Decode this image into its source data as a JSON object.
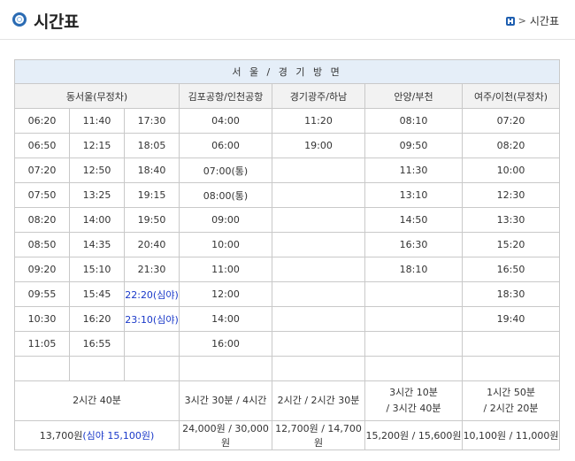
{
  "header": {
    "title": "시간표",
    "breadcrumb": "시간표"
  },
  "table": {
    "caption": "서 울 / 경 기 방 면",
    "columns": [
      "동서울(무정차)",
      "김포공항/인천공항",
      "경기광주/하남",
      "안양/부천",
      "여주/이천(무정차)"
    ],
    "rows": [
      [
        "06:20",
        "11:40",
        "17:30",
        "04:00",
        "11:20",
        "08:10",
        "07:20"
      ],
      [
        "06:50",
        "12:15",
        "18:05",
        "06:00",
        "19:00",
        "09:50",
        "08:20"
      ],
      [
        "07:20",
        "12:50",
        "18:40",
        "07:00(통)",
        "",
        "11:30",
        "10:00"
      ],
      [
        "07:50",
        "13:25",
        "19:15",
        "08:00(통)",
        "",
        "13:10",
        "12:30"
      ],
      [
        "08:20",
        "14:00",
        "19:50",
        "09:00",
        "",
        "14:50",
        "13:30"
      ],
      [
        "08:50",
        "14:35",
        "20:40",
        "10:00",
        "",
        "16:30",
        "15:20"
      ],
      [
        "09:20",
        "15:10",
        "21:30",
        "11:00",
        "",
        "18:10",
        "16:50"
      ],
      [
        "09:55",
        "15:45",
        "22:20(심야)",
        "12:00",
        "",
        "",
        "18:30"
      ],
      [
        "10:30",
        "16:20",
        "23:10(심야)",
        "14:00",
        "",
        "",
        "19:40"
      ],
      [
        "11:05",
        "16:55",
        "",
        "16:00",
        "",
        "",
        ""
      ],
      [
        "",
        "",
        "",
        "",
        "",
        "",
        ""
      ]
    ],
    "durations": [
      "2시간 40분",
      "3시간 30분 / 4시간",
      "2시간 / 2시간 30분",
      "3시간 10분 / 3시간 40분",
      "1시간 50분 / 2시간 20분"
    ],
    "fares": {
      "dongseoul": "13,700원",
      "dongseoul_night": "(심야 15,100원)",
      "gimpo": "24,000원 / 30,000원",
      "gwangju": "12,700원 / 14,700원",
      "anyang": "15,200원 / 15,600원",
      "yeoju": "10,100원 / 11,000원"
    }
  },
  "colors": {
    "accent": "#2a6bb3",
    "caption_bg": "#e5eef8",
    "header_bg": "#f2f2f2",
    "night_text": "#1a39c9"
  }
}
